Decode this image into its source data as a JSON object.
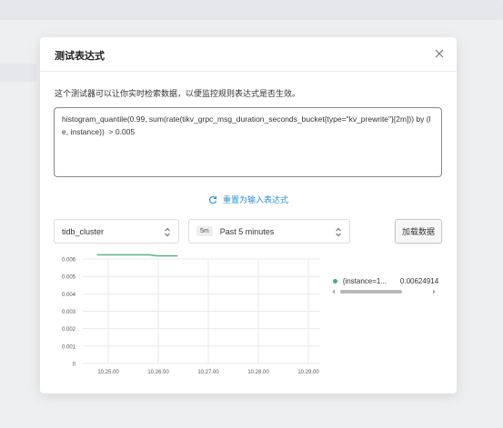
{
  "modal": {
    "title": "测试表达式",
    "description": "这个测试器可以让你实时检索数据，以便监控规则表达式是否生效。",
    "expression": "histogram_quantile(0.99, sum(rate(tikv_grpc_msg_duration_seconds_bucket{type=\"kv_prewrite\"}[2m])) by (le, instance))  > 0.005",
    "reset_label": "重置为输入表达式",
    "cluster_select": {
      "value": "tidb_cluster"
    },
    "time_select": {
      "tag": "5m",
      "value": "Past 5 minutes"
    },
    "load_button_label": "加载数据"
  },
  "legend": {
    "items": [
      {
        "name": "{instance=1...",
        "value": "0.00624914",
        "color": "#4caf7d"
      }
    ]
  },
  "chart_data": {
    "type": "line",
    "x_tick_labels": [
      "10.25.00",
      "10.26.00",
      "10.27.00",
      "10.28.00",
      "10.29.00"
    ],
    "y_tick_labels": [
      "0",
      "0.001",
      "0.002",
      "0.003",
      "0.004",
      "0.005",
      "0.006"
    ],
    "ylim": [
      0,
      0.006
    ],
    "xlim": [
      0,
      5
    ],
    "grid": true,
    "series": [
      {
        "color": "#4caf7d",
        "x": [
          0,
          1.1,
          1.25,
          1.7
        ],
        "y": [
          0.00624,
          0.00624,
          0.00618,
          0.00618
        ]
      }
    ]
  }
}
